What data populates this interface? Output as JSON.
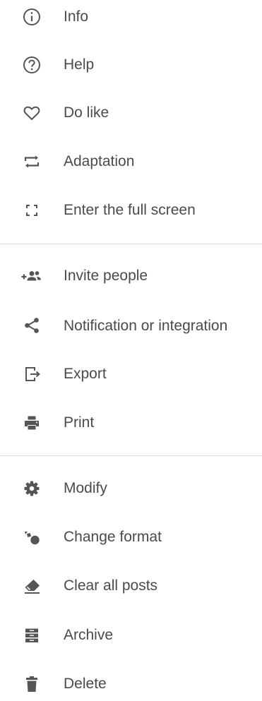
{
  "menu": {
    "items": [
      {
        "label": "Info",
        "icon": "info-icon"
      },
      {
        "label": "Help",
        "icon": "help-icon"
      },
      {
        "label": "Do like",
        "icon": "heart-icon"
      },
      {
        "label": "Adaptation",
        "icon": "adaptation-icon"
      },
      {
        "label": "Enter the full screen",
        "icon": "fullscreen-icon"
      },
      {
        "label": "Invite people",
        "icon": "invite-people-icon"
      },
      {
        "label": "Notification or integration",
        "icon": "share-icon"
      },
      {
        "label": "Export",
        "icon": "export-icon"
      },
      {
        "label": "Print",
        "icon": "print-icon"
      },
      {
        "label": "Modify",
        "icon": "gear-icon"
      },
      {
        "label": "Change format",
        "icon": "change-format-icon"
      },
      {
        "label": "Clear all posts",
        "icon": "eraser-icon"
      },
      {
        "label": "Archive",
        "icon": "archive-icon"
      },
      {
        "label": "Delete",
        "icon": "trash-icon"
      }
    ]
  },
  "colors": {
    "icon": "#555555",
    "text": "#4a4a4a",
    "divider": "#d8d8d8"
  }
}
